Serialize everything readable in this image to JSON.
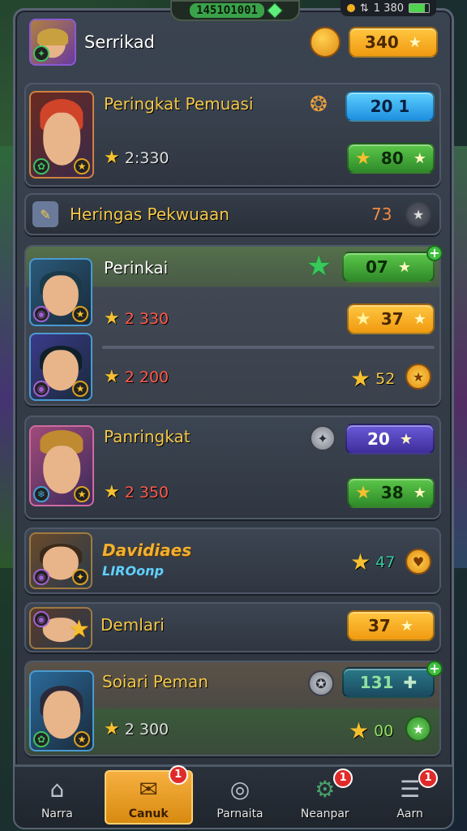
{
  "status": {
    "counter": "1451O1001",
    "clock": "1 380"
  },
  "header": {
    "title": "Serrikad",
    "currency": "340"
  },
  "cards": [
    {
      "name": "Peringkat Pemuasi",
      "score": "2:330",
      "top_value": "20 1",
      "bottom_value": "80"
    },
    {
      "name": "Heringas Pekwuaan",
      "value": "73"
    },
    {
      "name": "Perinkai",
      "score1": "2 330",
      "score2": "2 200",
      "top_value": "07",
      "mid_value": "37",
      "bottom_value": "52"
    },
    {
      "name": "Panringkat",
      "score": "2 350",
      "top_value": "20",
      "bottom_value": "38"
    },
    {
      "name": "Davidiaes",
      "sub": "LIROonp",
      "value": "47"
    },
    {
      "name": "Demlari",
      "value": "37"
    },
    {
      "name": "Soiari Peman",
      "score": "2 300",
      "top_value": "131",
      "bottom_value": "00"
    }
  ],
  "nav": [
    {
      "label": "Narra",
      "icon": "home-icon"
    },
    {
      "label": "Canuk",
      "icon": "mail-icon",
      "badge": "1"
    },
    {
      "label": "Parnaita",
      "icon": "alien-icon"
    },
    {
      "label": "Neanpar",
      "icon": "gear-icon",
      "badge": "1"
    },
    {
      "label": "Aarn",
      "icon": "menu-icon",
      "badge": "1"
    }
  ]
}
